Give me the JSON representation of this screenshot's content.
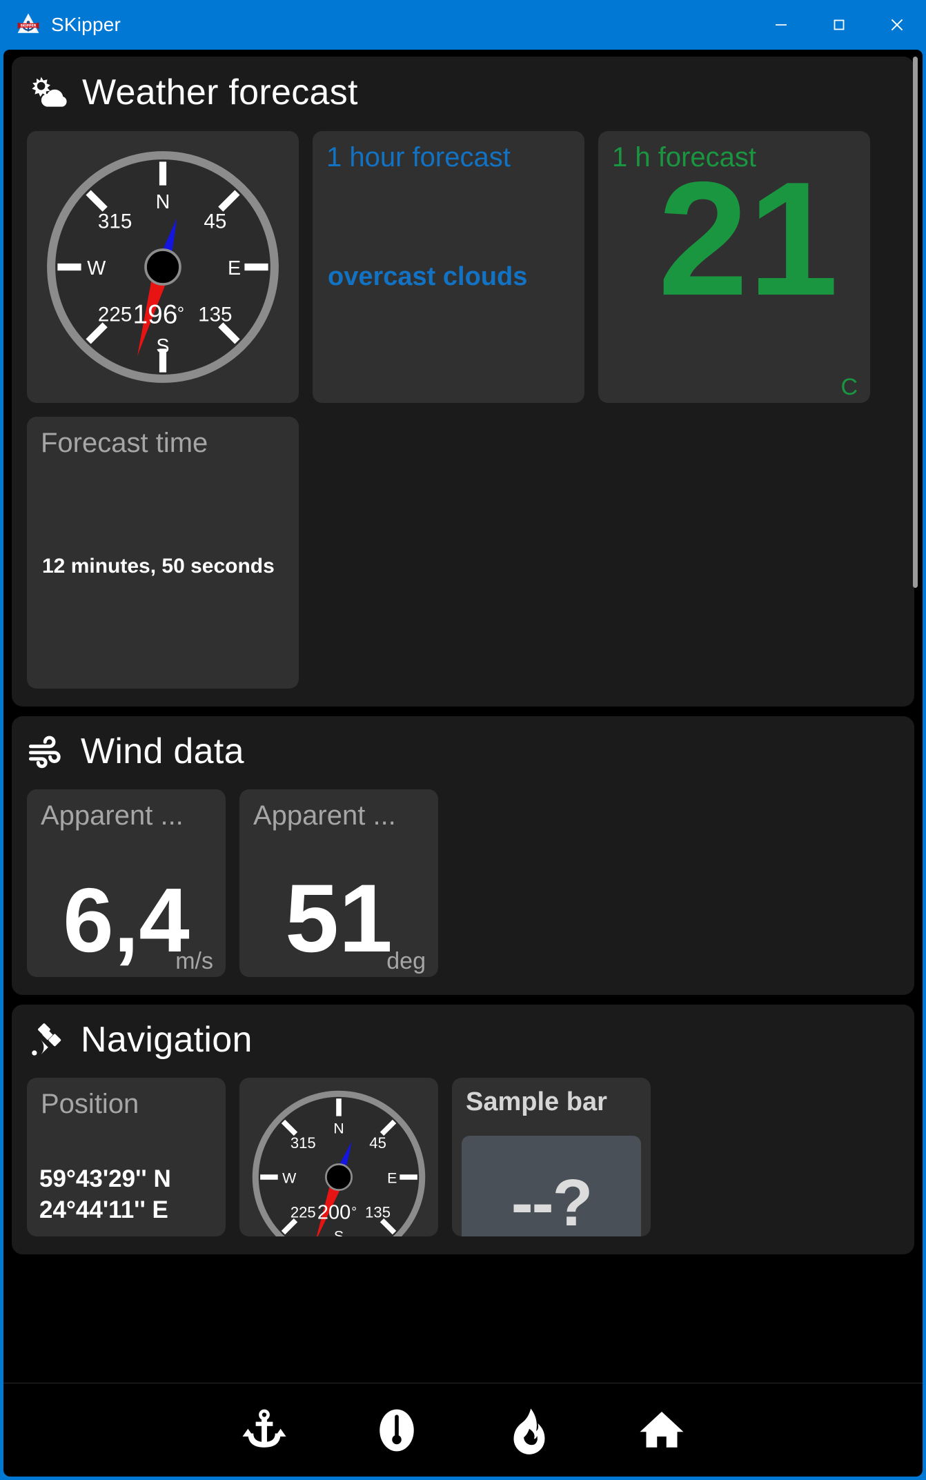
{
  "window": {
    "title": "SKipper",
    "logo_icon": "skipper-anchor-logo",
    "accent_color": "#0078d4",
    "controls": {
      "minimize": "minimize-icon",
      "maximize": "maximize-icon",
      "close": "close-icon"
    }
  },
  "sections": {
    "weather": {
      "title": "Weather forecast",
      "icon": "sun-cloud-icon",
      "compass": {
        "label_n": "N",
        "label_e": "E",
        "label_s": "S",
        "label_w": "W",
        "tick_45": "45",
        "tick_135": "135",
        "tick_225": "225",
        "tick_315": "315",
        "heading": "196",
        "degree_symbol": "°"
      },
      "forecast_condition": {
        "label": "1 hour forecast",
        "value": "overcast clouds",
        "color": "#1272c4"
      },
      "forecast_temp": {
        "label": "1 h forecast",
        "value": "21",
        "unit": "C",
        "color": "#1a9640"
      },
      "forecast_time": {
        "label": "Forecast time",
        "value": "12 minutes, 50 seconds"
      }
    },
    "wind": {
      "title": "Wind data",
      "icon": "wind-icon",
      "cards": [
        {
          "label": "Apparent ...",
          "value": "6,4",
          "unit": "m/s"
        },
        {
          "label": "Apparent ...",
          "value": "51",
          "unit": "deg"
        }
      ]
    },
    "navigation": {
      "title": "Navigation",
      "icon": "satellite-icon",
      "position": {
        "label": "Position",
        "latitude": "59°43'29'' N",
        "longitude": "24°44'11'' E"
      },
      "compass": {
        "label_n": "N",
        "label_e": "E",
        "label_s": "S",
        "label_w": "W",
        "tick_45": "45",
        "tick_135": "135",
        "tick_225": "225",
        "tick_315": "315",
        "heading": "200",
        "degree_symbol": "°"
      },
      "sample_bar": {
        "label": "Sample bar",
        "value": "--?"
      }
    }
  },
  "bottom_nav": {
    "items": [
      {
        "icon": "anchor-icon",
        "name": "anchor"
      },
      {
        "icon": "gauge-icon",
        "name": "gauge"
      },
      {
        "icon": "flame-icon",
        "name": "flame"
      },
      {
        "icon": "home-icon",
        "name": "home"
      }
    ]
  }
}
